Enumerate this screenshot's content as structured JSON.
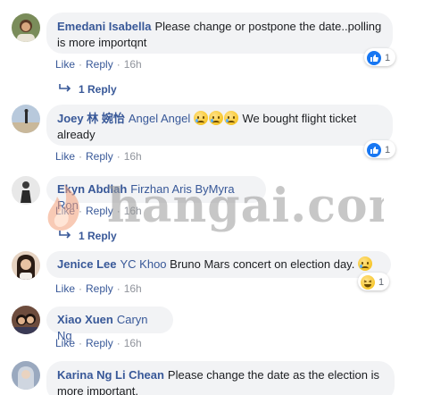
{
  "comments": [
    {
      "author": "Emedani Isabella",
      "text": "Please change or postpone the date..polling is more importqnt",
      "actions": {
        "like": "Like",
        "reply": "Reply",
        "time": "16h"
      },
      "reaction": {
        "icon": "like-icon",
        "count": "1"
      },
      "replies_label": "1 Reply",
      "avatar_color": "#7a8c5a"
    },
    {
      "author": "Joey 林 婉怡",
      "tag": "Angel Angel",
      "text": "We bought flight ticket already",
      "emoji_count": 3,
      "actions": {
        "like": "Like",
        "reply": "Reply",
        "time": "16h"
      },
      "reaction": {
        "icon": "like-icon",
        "count": "1"
      },
      "avatar_color": "#b8c9dc"
    },
    {
      "author": "Ekyn Abdlah",
      "tag": "Firzhan Aris ByMyra Ron",
      "actions": {
        "like": "Like",
        "reply": "Reply",
        "time": "16h"
      },
      "replies_label": "1 Reply",
      "avatar_color": "#4a4a4a"
    },
    {
      "author": "Jenice Lee",
      "tag": "YC Khoo",
      "text": "Bruno Mars concert on election day.",
      "actions": {
        "like": "Like",
        "reply": "Reply",
        "time": "16h"
      },
      "reaction": {
        "icon": "haha-icon",
        "count": "1"
      },
      "avatar_color": "#c9a27a"
    },
    {
      "author": "Xiao Xuen",
      "tag": "Caryn Ng",
      "actions": {
        "like": "Like",
        "reply": "Reply",
        "time": "16h"
      },
      "avatar_color": "#8a5a4a"
    },
    {
      "author": "Karina Ng Li Chean",
      "text": "Please change the date as the election is more important.",
      "avatar_color": "#9aa9bf"
    }
  ],
  "watermark": {
    "text": "hangai.com"
  },
  "colors": {
    "link": "#385898",
    "bubble": "#f2f3f5",
    "like_blue": "#1877f2"
  }
}
